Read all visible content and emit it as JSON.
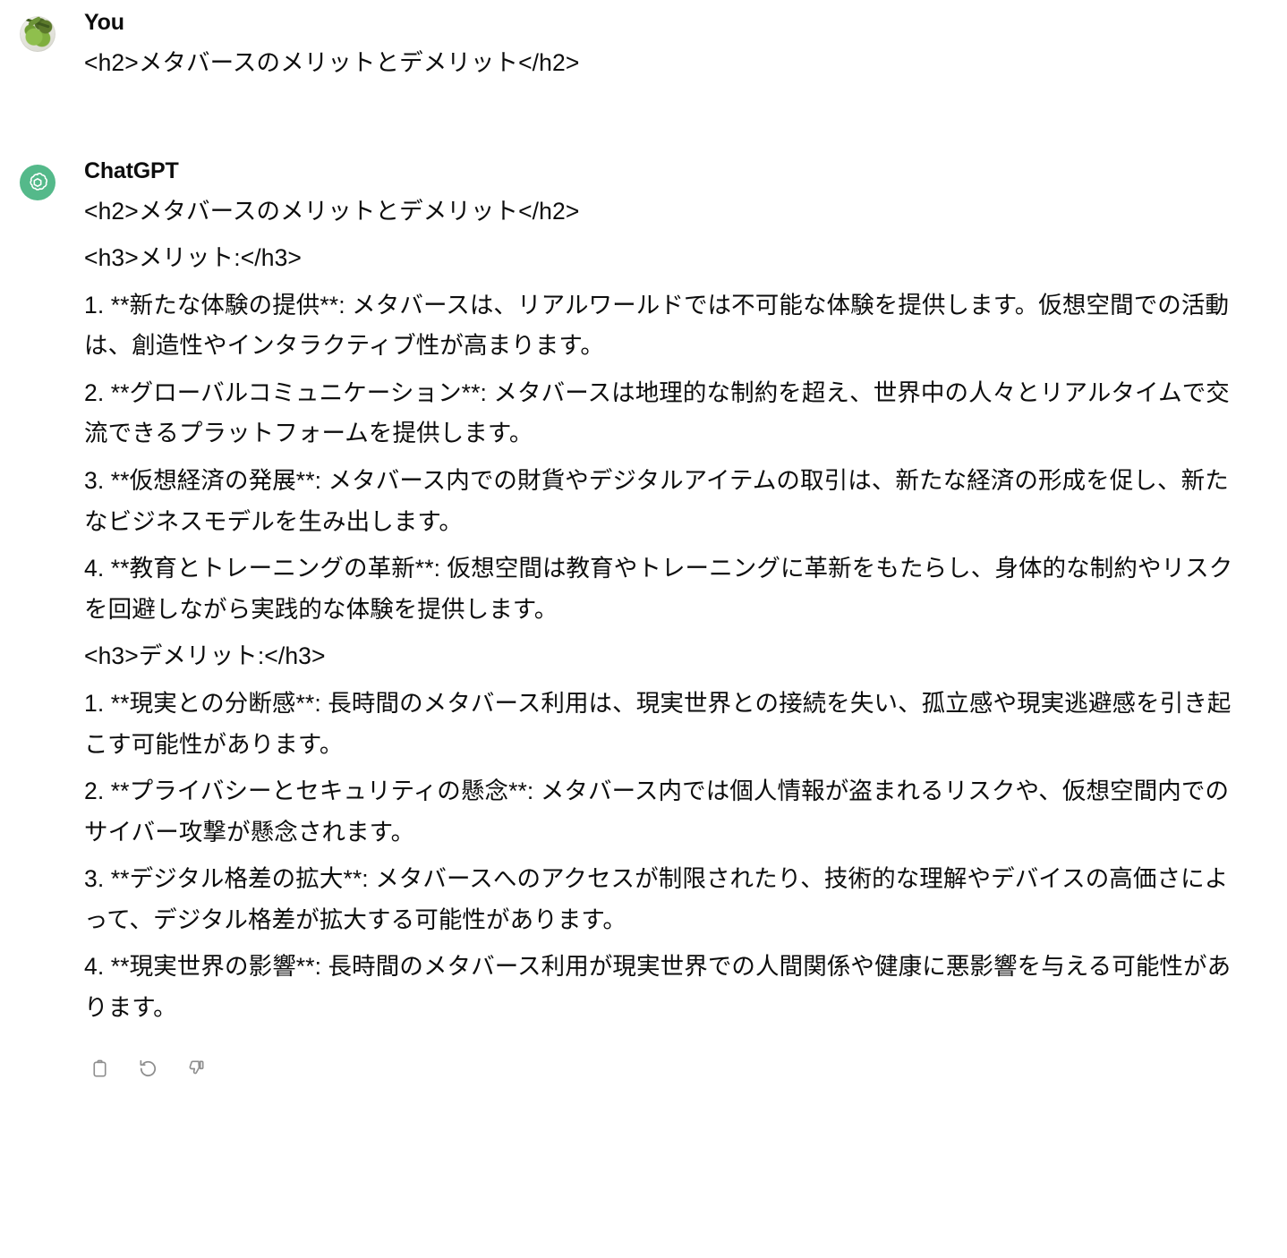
{
  "conversation": {
    "user_message": {
      "author": "You",
      "avatar_icon": "olives-photo-avatar",
      "text": "<h2>メタバースのメリットとデメリット</h2>"
    },
    "assistant_message": {
      "author": "ChatGPT",
      "avatar_icon": "openai-logo-icon",
      "avatar_color": "#54b98a",
      "paragraphs": [
        "<h2>メタバースのメリットとデメリット</h2>",
        "<h3>メリット:</h3>",
        "1. **新たな体験の提供**: メタバースは、リアルワールドでは不可能な体験を提供します。仮想空間での活動は、創造性やインタラクティブ性が高まります。",
        "2. **グローバルコミュニケーション**: メタバースは地理的な制約を超え、世界中の人々とリアルタイムで交流できるプラットフォームを提供します。",
        "3. **仮想経済の発展**: メタバース内での財貨やデジタルアイテムの取引は、新たな経済の形成を促し、新たなビジネスモデルを生み出します。",
        "4. **教育とトレーニングの革新**: 仮想空間は教育やトレーニングに革新をもたらし、身体的な制約やリスクを回避しながら実践的な体験を提供します。",
        "<h3>デメリット:</h3>",
        "1. **現実との分断感**: 長時間のメタバース利用は、現実世界との接続を失い、孤立感や現実逃避感を引き起こす可能性があります。",
        "2. **プライバシーとセキュリティの懸念**: メタバース内では個人情報が盗まれるリスクや、仮想空間内でのサイバー攻撃が懸念されます。",
        "3. **デジタル格差の拡大**: メタバースへのアクセスが制限されたり、技術的な理解やデバイスの高価さによって、デジタル格差が拡大する可能性があります。",
        "4. **現実世界の影響**: 長時間のメタバース利用が現実世界での人間関係や健康に悪影響を与える可能性があります。"
      ],
      "actions": [
        {
          "name": "copy-icon",
          "label": "コピー"
        },
        {
          "name": "regenerate-icon",
          "label": "再生成"
        },
        {
          "name": "thumbs-down-icon",
          "label": "悪い回答"
        }
      ]
    }
  }
}
